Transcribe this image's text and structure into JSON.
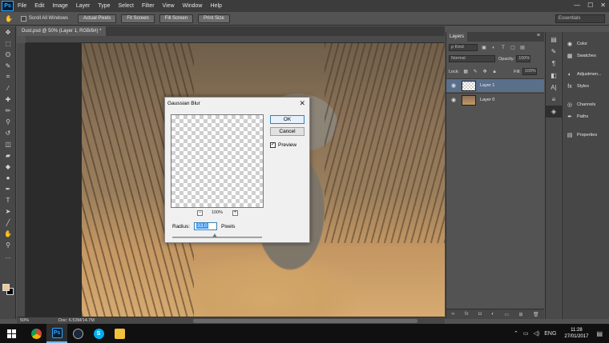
{
  "app": {
    "logo": "Ps"
  },
  "menu": [
    "File",
    "Edit",
    "Image",
    "Layer",
    "Type",
    "Select",
    "Filter",
    "View",
    "Window",
    "Help"
  ],
  "window_controls": {
    "minimize": "—",
    "maximize": "☐",
    "close": "✕"
  },
  "options_bar": {
    "scroll_all_windows": "Scroll All Windows",
    "buttons": [
      "Actual Pixels",
      "Fit Screen",
      "Fill Screen",
      "Print Size"
    ],
    "workspace": "Essentials"
  },
  "document": {
    "tab_title": "Dust.psd @ 50% (Layer 1, RGB/8#) *",
    "zoom": "50%",
    "doc_info": "Doc: 6.53M/14.7M"
  },
  "dialog": {
    "title": "Gaussian Blur",
    "close": "✕",
    "ok_label": "OK",
    "cancel_label": "Cancel",
    "preview_label": "Preview",
    "preview_checked": "✓",
    "zoom_out": "−",
    "zoom_in": "+",
    "zoom_level": "100%",
    "radius_label": "Radius:",
    "radius_value": "33.0",
    "radius_unit": "Pixels"
  },
  "layers_panel": {
    "tab": "Layers",
    "filter_kind": "ρ Kind",
    "blend_mode": "Normal",
    "opacity_label": "Opacity:",
    "opacity_value": "100%",
    "lock_label": "Lock:",
    "fill_label": "Fill:",
    "fill_value": "100%",
    "layers": [
      {
        "name": "Layer 1",
        "selected": true
      },
      {
        "name": "Layer 0",
        "selected": false
      }
    ],
    "footer_icons": [
      "link-icon",
      "fx-icon",
      "mask-icon",
      "adjustment-icon",
      "folder-icon",
      "new-layer-icon",
      "trash-icon"
    ]
  },
  "right_panels": [
    "Color",
    "Swatches",
    "Adjustmen...",
    "Styles",
    "Channels",
    "Paths",
    "Properties"
  ],
  "taskbar": {
    "apps": [
      "chrome-icon",
      "photoshop-icon",
      "steam-icon",
      "skype-icon",
      "file-explorer-icon"
    ],
    "language": "ENG",
    "time": "11:28",
    "date": "27/01/2017"
  },
  "colors": {
    "foreground": "#f0c890",
    "background": "#000000",
    "selected_layer": "#596f8a",
    "accent": "#31a8ff"
  }
}
